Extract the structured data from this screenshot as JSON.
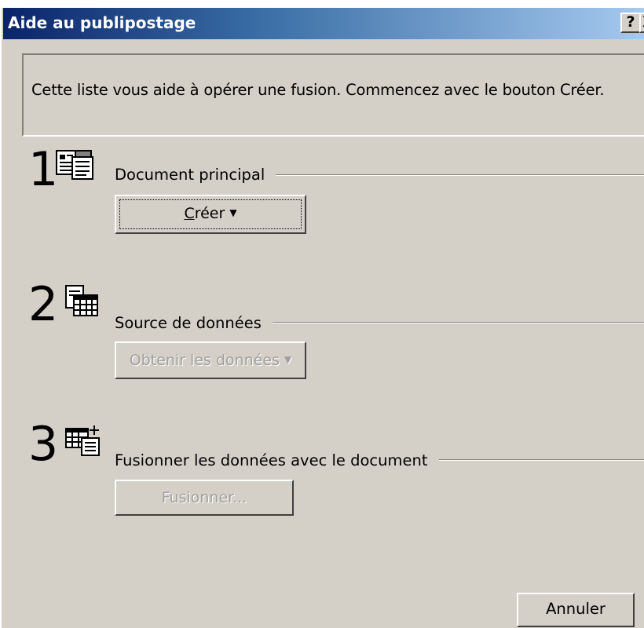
{
  "window": {
    "title": "Aide au publipostage",
    "help_button": "?",
    "close_button": "X"
  },
  "info": {
    "text": "Cette liste vous aide à opérer une fusion. Commencez avec le bouton Créer."
  },
  "steps": [
    {
      "number": "1",
      "icon": "main-document-icon",
      "label": "Document principal",
      "button": {
        "label": "Créer",
        "accelerator": "C",
        "rest": "réer",
        "caret": "▼",
        "enabled": true
      }
    },
    {
      "number": "2",
      "icon": "data-source-table-icon",
      "label": "Source de données",
      "button": {
        "label": "Obtenir les données",
        "caret": "▼",
        "enabled": false
      }
    },
    {
      "number": "3",
      "icon": "merge-data-icon",
      "label": "Fusionner les données avec le document",
      "button": {
        "label": "Fusionner...",
        "enabled": false
      }
    }
  ],
  "footer": {
    "cancel_label": "Annuler"
  }
}
